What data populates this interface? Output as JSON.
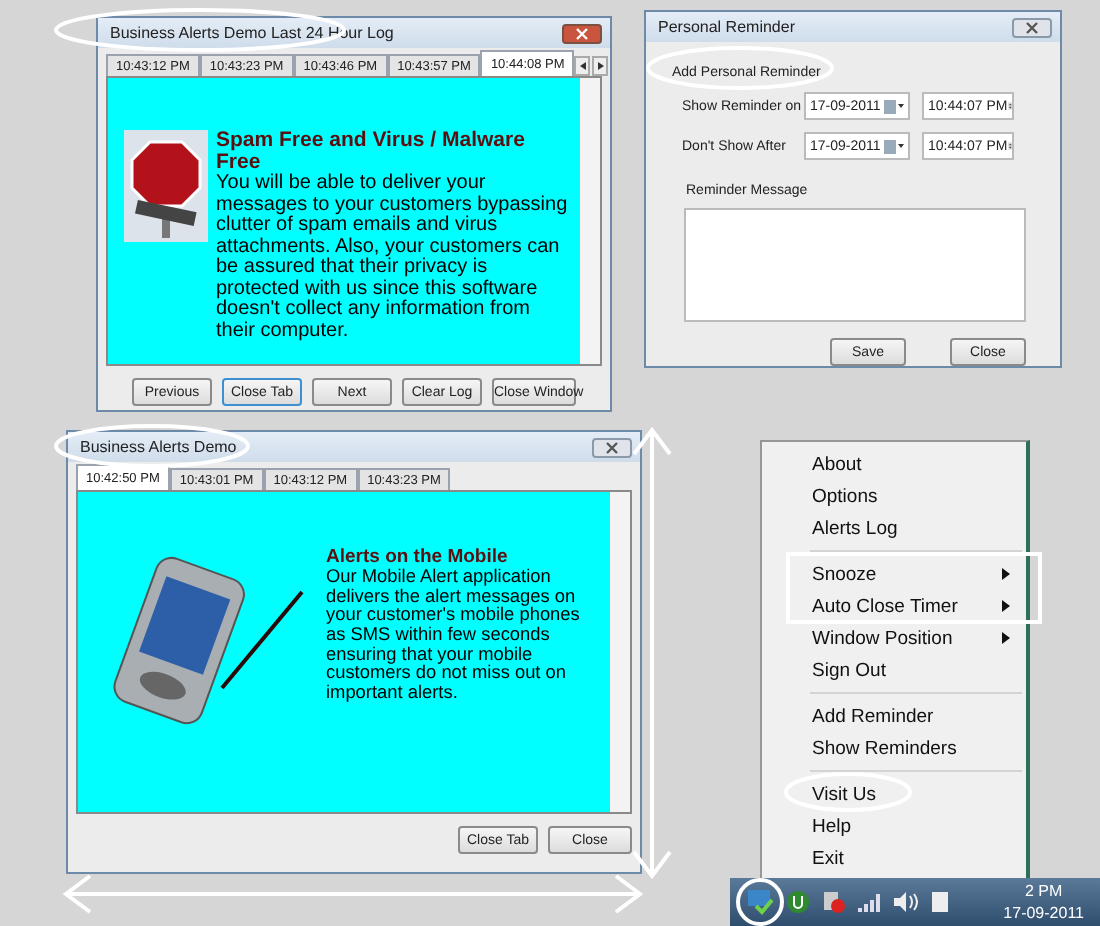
{
  "log_window": {
    "title": "Business Alerts Demo Last 24 Hour Log",
    "tabs": [
      {
        "label": "10:43:12 PM",
        "selected": false
      },
      {
        "label": "10:43:23 PM",
        "selected": false
      },
      {
        "label": "10:43:46 PM",
        "selected": false
      },
      {
        "label": "10:43:57 PM",
        "selected": false
      },
      {
        "label": "10:44:08 PM",
        "selected": true
      }
    ],
    "heading": "Spam Free and Virus / Malware Free",
    "body": "You will be able to deliver your messages to your customers bypassing clutter of spam emails and virus attachments. Also, your customers can be assured that their privacy is protected with us since this software doesn't collect any information from their computer.",
    "buttons": [
      {
        "label": "Previous",
        "focused": false
      },
      {
        "label": "Close Tab",
        "focused": true
      },
      {
        "label": "Next",
        "focused": false
      },
      {
        "label": "Clear Log",
        "focused": false
      },
      {
        "label": "Close Window",
        "focused": false
      }
    ]
  },
  "reminder_window": {
    "title": "Personal Reminder",
    "group_label": "Add Personal Reminder",
    "fields": [
      {
        "label": "Show Reminder on",
        "date": "17-09-2011",
        "time": "10:44:07 PM"
      },
      {
        "label": "Don't Show After",
        "date": "17-09-2011",
        "time": "10:44:07 PM"
      }
    ],
    "message_label": "Reminder Message",
    "buttons": [
      {
        "label": "Save"
      },
      {
        "label": "Close"
      }
    ]
  },
  "demo_window": {
    "title": "Business Alerts Demo",
    "tabs": [
      {
        "label": "10:42:50 PM",
        "selected": true
      },
      {
        "label": "10:43:01 PM",
        "selected": false
      },
      {
        "label": "10:43:12 PM",
        "selected": false
      },
      {
        "label": "10:43:23 PM",
        "selected": false
      }
    ],
    "heading": "Alerts on the Mobile",
    "body": "Our Mobile Alert application delivers the alert messages on your customer's mobile phones as SMS within few seconds ensuring that your mobile customers do not miss out on important alerts.",
    "buttons": [
      {
        "label": "Close Tab"
      },
      {
        "label": "Close"
      }
    ]
  },
  "tray_menu": {
    "groups": [
      [
        {
          "label": "About",
          "submenu": false
        },
        {
          "label": "Options",
          "submenu": false
        },
        {
          "label": "Alerts Log",
          "submenu": false
        }
      ],
      [
        {
          "label": "Snooze",
          "submenu": true
        },
        {
          "label": "Auto Close Timer",
          "submenu": true
        },
        {
          "label": "Window Position",
          "submenu": true
        },
        {
          "label": "Sign Out",
          "submenu": false
        }
      ],
      [
        {
          "label": "Add Reminder",
          "submenu": false
        },
        {
          "label": "Show Reminders",
          "submenu": false
        }
      ],
      [
        {
          "label": "Visit Us",
          "submenu": false
        },
        {
          "label": "Help",
          "submenu": false
        },
        {
          "label": "Exit",
          "submenu": false
        }
      ]
    ]
  },
  "taskbar": {
    "time": "2 PM",
    "date": "17-09-2011"
  }
}
